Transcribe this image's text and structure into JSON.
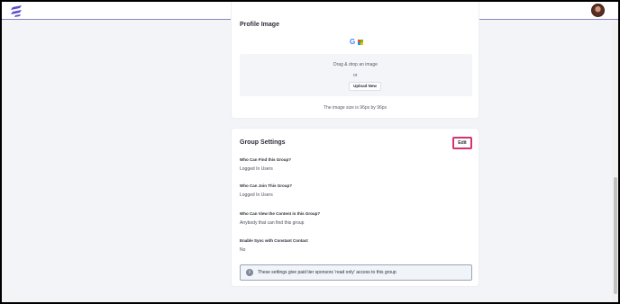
{
  "profile": {
    "title": "Profile Image",
    "drop_text": "Drag & drop an image",
    "or_text": "or",
    "upload_label": "Upload New",
    "size_note": "The image size is 96px by 96px"
  },
  "group_settings": {
    "title": "Group Settings",
    "edit_label": "Edit",
    "fields": [
      {
        "label": "Who Can Find this Group?",
        "value": "Logged In Users"
      },
      {
        "label": "Who Can Join This Group?",
        "value": "Logged In Users"
      },
      {
        "label": "Who Can View the Content in this Group?",
        "value": "Anybody that can find this group"
      },
      {
        "label": "Enable Sync with Constant Contact",
        "value": "No"
      }
    ],
    "info_text": "These settings give paid tier sponsors 'read only' access to this group"
  },
  "icons": {
    "logo": "app-logo-icon",
    "google": "google-icon",
    "microsoft": "microsoft-icon",
    "info": "info-icon",
    "avatar": "user-avatar"
  },
  "colors": {
    "accent": "#d6336c",
    "logo": "#5b4fc9"
  }
}
